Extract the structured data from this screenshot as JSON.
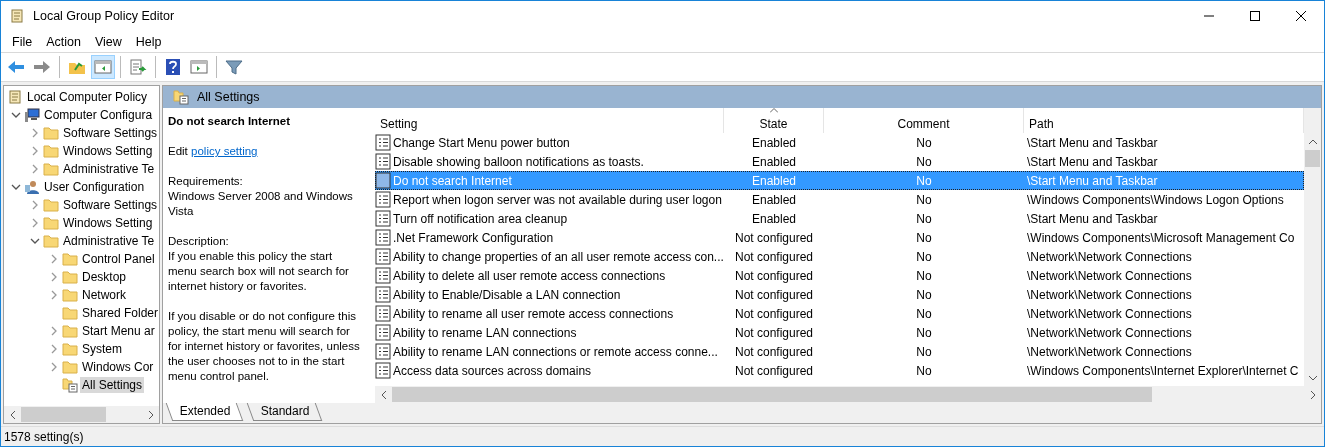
{
  "window": {
    "title": "Local Group Policy Editor"
  },
  "menu": [
    {
      "label": "File"
    },
    {
      "label": "Action"
    },
    {
      "label": "View"
    },
    {
      "label": "Help"
    }
  ],
  "toolbar": [
    {
      "disabled": false,
      "pressed": false
    },
    {
      "disabled": true,
      "pressed": false
    },
    {
      "disabled": false,
      "pressed": false
    },
    {
      "disabled": false,
      "pressed": true
    },
    {
      "disabled": false,
      "pressed": false
    },
    {
      "disabled": false,
      "pressed": false
    },
    {
      "disabled": false,
      "pressed": false
    },
    {
      "disabled": false,
      "pressed": false
    }
  ],
  "tree": [
    {
      "label": "Local Computer Policy",
      "kind": "root",
      "selected": false,
      "children": [
        {
          "label": "Computer Configura",
          "kind": "computer",
          "expanded": true,
          "selected": false,
          "children": [
            {
              "label": "Software Settings",
              "kind": "folder",
              "expanded": false,
              "selected": false
            },
            {
              "label": "Windows Setting",
              "kind": "folder",
              "expanded": false,
              "selected": false
            },
            {
              "label": "Administrative Te",
              "kind": "folder",
              "expanded": false,
              "selected": false
            }
          ]
        },
        {
          "label": "User Configuration",
          "kind": "user",
          "expanded": true,
          "selected": false,
          "children": [
            {
              "label": "Software Settings",
              "kind": "folder",
              "expanded": false,
              "selected": false
            },
            {
              "label": "Windows Setting",
              "kind": "folder",
              "expanded": false,
              "selected": false
            },
            {
              "label": "Administrative Te",
              "kind": "folder",
              "expanded": true,
              "selected": false,
              "children": [
                {
                  "label": "Control Panel",
                  "kind": "folder",
                  "expanded": false,
                  "selected": false
                },
                {
                  "label": "Desktop",
                  "kind": "folder",
                  "expanded": false,
                  "selected": false
                },
                {
                  "label": "Network",
                  "kind": "folder",
                  "expanded": false,
                  "selected": false
                },
                {
                  "label": "Shared Folder",
                  "kind": "folder",
                  "selected": false
                },
                {
                  "label": "Start Menu ar",
                  "kind": "folder",
                  "expanded": false,
                  "selected": false
                },
                {
                  "label": "System",
                  "kind": "folder",
                  "expanded": false,
                  "selected": false
                },
                {
                  "label": "Windows Cor",
                  "kind": "folder",
                  "expanded": false,
                  "selected": false
                },
                {
                  "label": "All Settings",
                  "kind": "settings",
                  "selected": true
                }
              ]
            }
          ]
        }
      ]
    }
  ],
  "pane": {
    "title": "All Settings"
  },
  "details": {
    "title": "Do not search Internet",
    "edit_prefix": "Edit",
    "edit_link": "policy setting",
    "requirements_label": "Requirements:",
    "requirements": "Windows Server 2008 and Windows Vista",
    "description_label": "Description:",
    "description": [
      "If you enable this policy the start menu search box will not search for internet history or favorites.",
      "If you disable or do not configure this policy, the start menu will search for for internet history or favorites, unless the user chooses not to in the start menu control panel."
    ]
  },
  "table": {
    "columns": [
      {
        "label": "Setting",
        "sorted": false
      },
      {
        "label": "State",
        "sorted": true
      },
      {
        "label": "Comment",
        "sorted": false
      },
      {
        "label": "Path",
        "sorted": false
      }
    ],
    "rows": [
      {
        "setting": "Change Start Menu power button",
        "state": "Enabled",
        "comment": "No",
        "path": "\\Start Menu and Taskbar",
        "selected": false
      },
      {
        "setting": "Disable showing balloon notifications as toasts.",
        "state": "Enabled",
        "comment": "No",
        "path": "\\Start Menu and Taskbar",
        "selected": false
      },
      {
        "setting": "Do not search Internet",
        "state": "Enabled",
        "comment": "No",
        "path": "\\Start Menu and Taskbar",
        "selected": true
      },
      {
        "setting": "Report when logon server was not available during user logon",
        "state": "Enabled",
        "comment": "No",
        "path": "\\Windows Components\\Windows Logon Options",
        "selected": false
      },
      {
        "setting": "Turn off notification area cleanup",
        "state": "Enabled",
        "comment": "No",
        "path": "\\Start Menu and Taskbar",
        "selected": false
      },
      {
        "setting": ".Net Framework Configuration",
        "state": "Not configured",
        "comment": "No",
        "path": "\\Windows Components\\Microsoft Management Co",
        "selected": false
      },
      {
        "setting": "Ability to change properties of an all user remote access con...",
        "state": "Not configured",
        "comment": "No",
        "path": "\\Network\\Network Connections",
        "selected": false
      },
      {
        "setting": "Ability to delete all user remote access connections",
        "state": "Not configured",
        "comment": "No",
        "path": "\\Network\\Network Connections",
        "selected": false
      },
      {
        "setting": "Ability to Enable/Disable a LAN connection",
        "state": "Not configured",
        "comment": "No",
        "path": "\\Network\\Network Connections",
        "selected": false
      },
      {
        "setting": "Ability to rename all user remote access connections",
        "state": "Not configured",
        "comment": "No",
        "path": "\\Network\\Network Connections",
        "selected": false
      },
      {
        "setting": "Ability to rename LAN connections",
        "state": "Not configured",
        "comment": "No",
        "path": "\\Network\\Network Connections",
        "selected": false
      },
      {
        "setting": "Ability to rename LAN connections or remote access conne...",
        "state": "Not configured",
        "comment": "No",
        "path": "\\Network\\Network Connections",
        "selected": false
      },
      {
        "setting": "Access data sources across domains",
        "state": "Not configured",
        "comment": "No",
        "path": "\\Windows Components\\Internet Explorer\\Internet C",
        "selected": false
      }
    ]
  },
  "view_tabs": [
    {
      "label": "Extended",
      "selected": true
    },
    {
      "label": "Standard",
      "selected": false
    }
  ],
  "status_bar": "1578 setting(s)"
}
